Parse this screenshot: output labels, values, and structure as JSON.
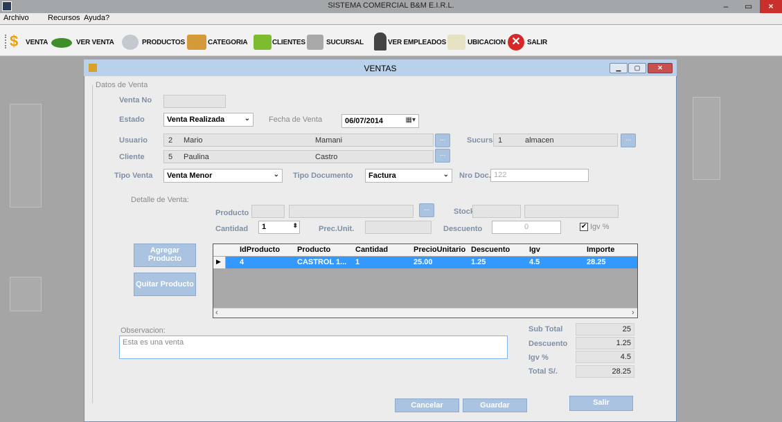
{
  "window": {
    "title": "SISTEMA COMERCIAL B&M E.I.R.L.",
    "min": "–",
    "max": "▭",
    "close": "×"
  },
  "menu": [
    "Archivo",
    "Recursos",
    "Ayuda?"
  ],
  "toolbar": {
    "venta": "VENTA",
    "ver_venta": "VER VENTA",
    "productos": "PRODUCTOS",
    "categoria": "CATEGORIA",
    "clientes": "CLIENTES",
    "sucursal": "SUCURSAL",
    "ver_empleados": "VER EMPLEADOS",
    "ubicacion": "UBICACION",
    "salir": "SALIR"
  },
  "dialog": {
    "title": "VENTAS",
    "group": "Datos de Venta",
    "venta_no_label": "Venta No",
    "venta_no": "",
    "estado_label": "Estado",
    "estado": "Venta Realizada",
    "fecha_label": "Fecha de Venta",
    "fecha": "06/07/2014",
    "usuario_label": "Usuario",
    "usuario_id": "2",
    "usuario_nombre": "Mario",
    "usuario_apellido": "Mamani",
    "sucursal_label": "Sucursal",
    "sucursal_id": "1",
    "sucursal_nombre": "almacen",
    "cliente_label": "Cliente",
    "cliente_id": "5",
    "cliente_nombre": "Paulina",
    "cliente_apellido": "Castro",
    "tipo_venta_label": "Tipo Venta",
    "tipo_venta": "Venta Menor",
    "tipo_doc_label": "Tipo Documento",
    "tipo_doc": "Factura",
    "nro_doc_label": "Nro Doc.",
    "nro_doc": "122",
    "detalle_label": "Detalle de Venta:",
    "producto_label": "Producto",
    "stock_label": "Stock",
    "cantidad_label": "Cantidad",
    "cantidad": "1",
    "prec_unit_label": "Prec.Unit.",
    "descuento_label": "Descuento",
    "descuento": "0",
    "igv_label": "Igv %",
    "agregar": "Agregar Producto",
    "quitar": "Quitar Producto",
    "observacion_label": "Observacion:",
    "observacion": "Esta es una venta",
    "subtotal_label": "Sub Total",
    "subtotal": "25",
    "descuento_total_label": "Descuento",
    "descuento_total": "1.25",
    "igv_total_label": "Igv %",
    "igv_total": "4.5",
    "total_label": "Total  S/.",
    "total": "28.25",
    "cancelar": "Cancelar",
    "guardar": "Guardar",
    "salir": "Salir"
  },
  "grid": {
    "columns": [
      "IdProducto",
      "Producto",
      "Cantidad",
      "PrecioUnitario",
      "Descuento",
      "Igv",
      "Importe"
    ],
    "rows": [
      [
        "4",
        "CASTROL 1...",
        "1",
        "25.00",
        "1.25",
        "4.5",
        "28.25"
      ]
    ]
  }
}
